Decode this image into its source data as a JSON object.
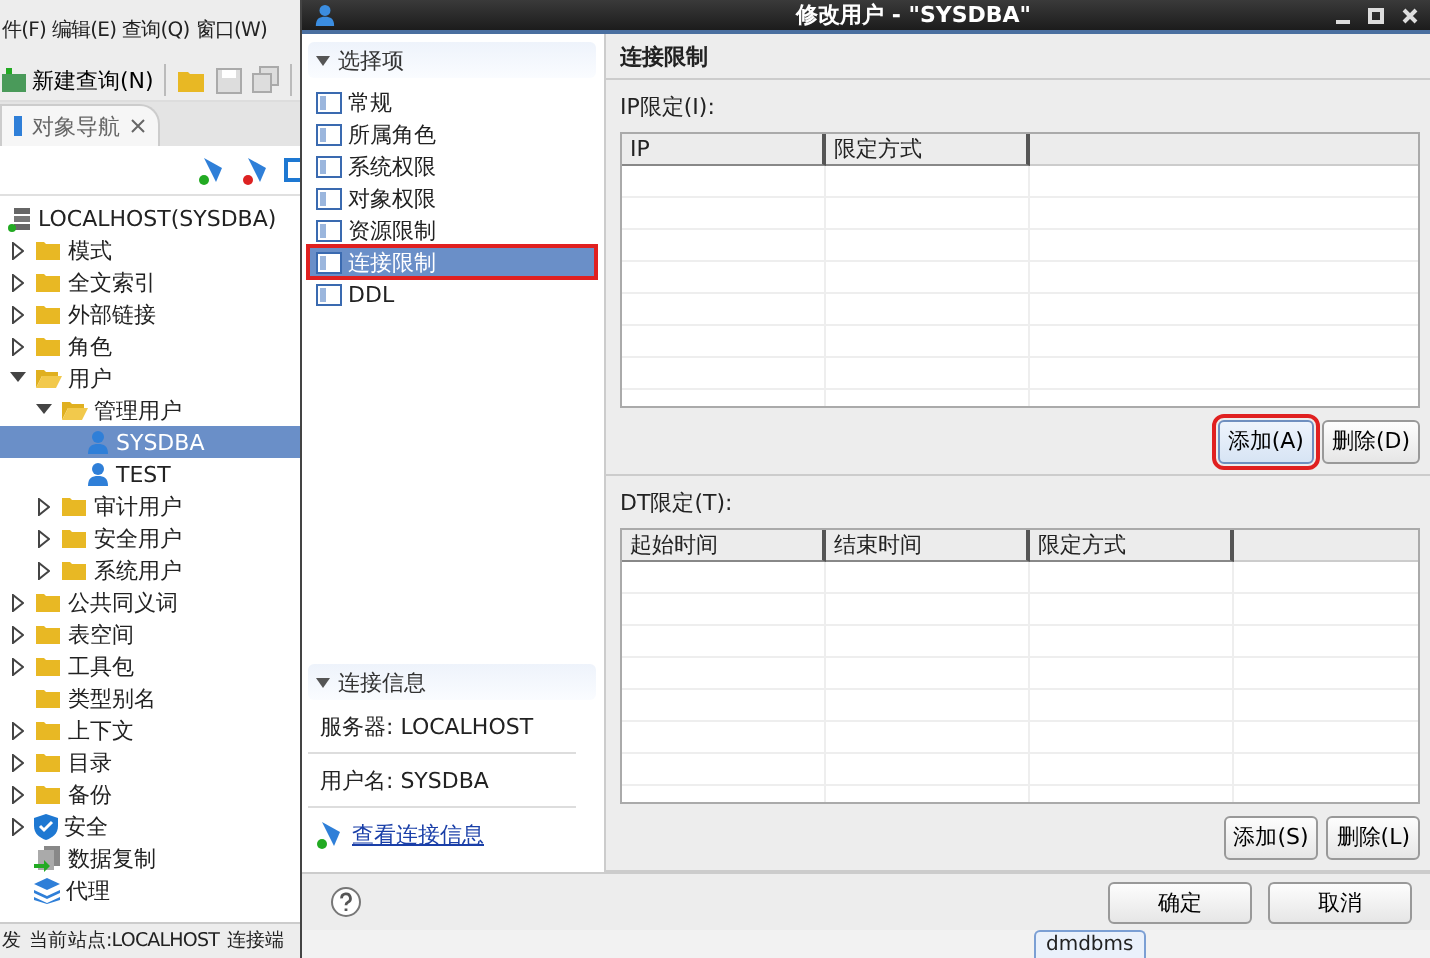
{
  "app": {
    "menu": [
      "件(F)",
      "编辑(E)",
      "查询(Q)",
      "窗口(W)"
    ],
    "toolbar": {
      "new_query": "新建查询(N)"
    },
    "nav_tab": {
      "label": "对象导航"
    },
    "tree": [
      {
        "label": "LOCALHOST(SYSDBA)",
        "kind": "server",
        "selected": false,
        "children": [
          {
            "label": "模式",
            "kind": "folder",
            "expanded": false,
            "selected": false
          },
          {
            "label": "全文索引",
            "kind": "folder",
            "expanded": false,
            "selected": false
          },
          {
            "label": "外部链接",
            "kind": "folder",
            "expanded": false,
            "selected": false
          },
          {
            "label": "角色",
            "kind": "folder",
            "expanded": false,
            "selected": false
          },
          {
            "label": "用户",
            "kind": "folder-open",
            "expanded": true,
            "selected": false,
            "children": [
              {
                "label": "管理用户",
                "kind": "folder-open",
                "expanded": true,
                "selected": false,
                "children": [
                  {
                    "label": "SYSDBA",
                    "kind": "user",
                    "selected": true
                  },
                  {
                    "label": "TEST",
                    "kind": "user",
                    "selected": false
                  }
                ]
              },
              {
                "label": "审计用户",
                "kind": "folder",
                "expanded": false,
                "selected": false
              },
              {
                "label": "安全用户",
                "kind": "folder",
                "expanded": false,
                "selected": false
              },
              {
                "label": "系统用户",
                "kind": "folder",
                "expanded": false,
                "selected": false
              }
            ]
          },
          {
            "label": "公共同义词",
            "kind": "folder",
            "expanded": false,
            "selected": false
          },
          {
            "label": "表空间",
            "kind": "folder",
            "expanded": false,
            "selected": false
          },
          {
            "label": "工具包",
            "kind": "folder",
            "expanded": false,
            "selected": false
          },
          {
            "label": "类型别名",
            "kind": "folder",
            "selected": false
          },
          {
            "label": "上下文",
            "kind": "folder",
            "expanded": false,
            "selected": false
          },
          {
            "label": "目录",
            "kind": "folder",
            "expanded": false,
            "selected": false
          },
          {
            "label": "备份",
            "kind": "folder",
            "expanded": false,
            "selected": false
          },
          {
            "label": "安全",
            "kind": "shield",
            "expanded": false,
            "selected": false
          },
          {
            "label": "数据复制",
            "kind": "replicate",
            "selected": false
          },
          {
            "label": "代理",
            "kind": "layers",
            "selected": false
          }
        ]
      }
    ],
    "status_bar": [
      "发",
      "当前站点:LOCALHOST",
      "连接端"
    ]
  },
  "dialog": {
    "title": "修改用户 - \"SYSDBA\"",
    "nav": {
      "title": "选择项",
      "items": [
        {
          "label": "常规",
          "selected": false,
          "highlighted": false
        },
        {
          "label": "所属角色",
          "selected": false,
          "highlighted": false
        },
        {
          "label": "系统权限",
          "selected": false,
          "highlighted": false
        },
        {
          "label": "对象权限",
          "selected": false,
          "highlighted": false
        },
        {
          "label": "资源限制",
          "selected": false,
          "highlighted": false
        },
        {
          "label": "连接限制",
          "selected": true,
          "highlighted": true
        },
        {
          "label": "DDL",
          "selected": false,
          "highlighted": false
        }
      ]
    },
    "connection_info": {
      "title": "连接信息",
      "server": "服务器: LOCALHOST",
      "user": "用户名: SYSDBA",
      "link": "查看连接信息"
    },
    "page_title": "连接限制",
    "sections": [
      {
        "label": "IP限定(I):",
        "columns": [
          "IP",
          "限定方式"
        ],
        "buttons": [
          {
            "label": "添加(A)",
            "highlighted": true
          },
          {
            "label": "删除(D)",
            "highlighted": false
          }
        ]
      },
      {
        "label": "DT限定(T):",
        "columns": [
          "起始时间",
          "结束时间",
          "限定方式"
        ],
        "buttons": [
          {
            "label": "添加(S)",
            "highlighted": false
          },
          {
            "label": "删除(L)",
            "highlighted": false
          }
        ]
      }
    ],
    "buttons": [
      "确定",
      "取消"
    ],
    "taskbar_tab": "dmdbms"
  }
}
